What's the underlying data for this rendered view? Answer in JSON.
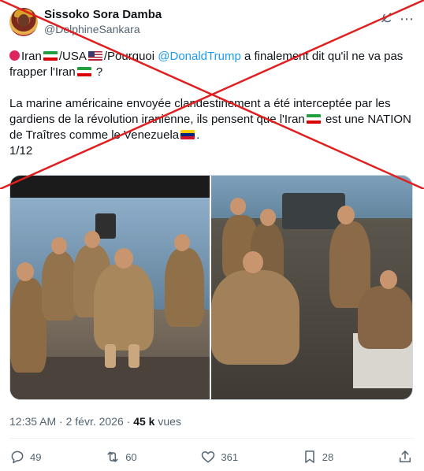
{
  "author": {
    "display_name": "Sissoko Sora Damba",
    "handle": "@DelphineSankara"
  },
  "icons": {
    "avatar": "profile-avatar",
    "grok": "grok-icon",
    "more": "more-icon",
    "reply": "reply-icon",
    "retweet": "retweet-icon",
    "like": "heart-icon",
    "bookmark": "bookmark-icon",
    "share": "share-icon"
  },
  "post": {
    "line1_a": "Iran",
    "line1_b": "/USA",
    "line1_c": "/Pourquoi ",
    "mention": "@DonaldTrump",
    "line1_d": " a finalement dit qu'il ne va pas frapper l'Iran",
    "line1_e": " ?",
    "line2_a": "La marine américaine envoyée clandestinement a été interceptée par les gardiens de la révolution iranienne, ils pensent que l'Iran",
    "line2_b": " est une NATION de Traîtres comme le Venezuela",
    "line2_c": ".",
    "counter": "1/12"
  },
  "meta": {
    "time_date": "12:35 AM · 2 févr. 2026 · ",
    "views_count": "45 k",
    "views_label": " vues"
  },
  "actions": {
    "replies": "49",
    "retweets": "60",
    "likes": "361",
    "bookmarks": "28"
  },
  "colors": {
    "mention": "#1d9bf0",
    "cross": "#e02020",
    "secondary_text": "#536471"
  }
}
